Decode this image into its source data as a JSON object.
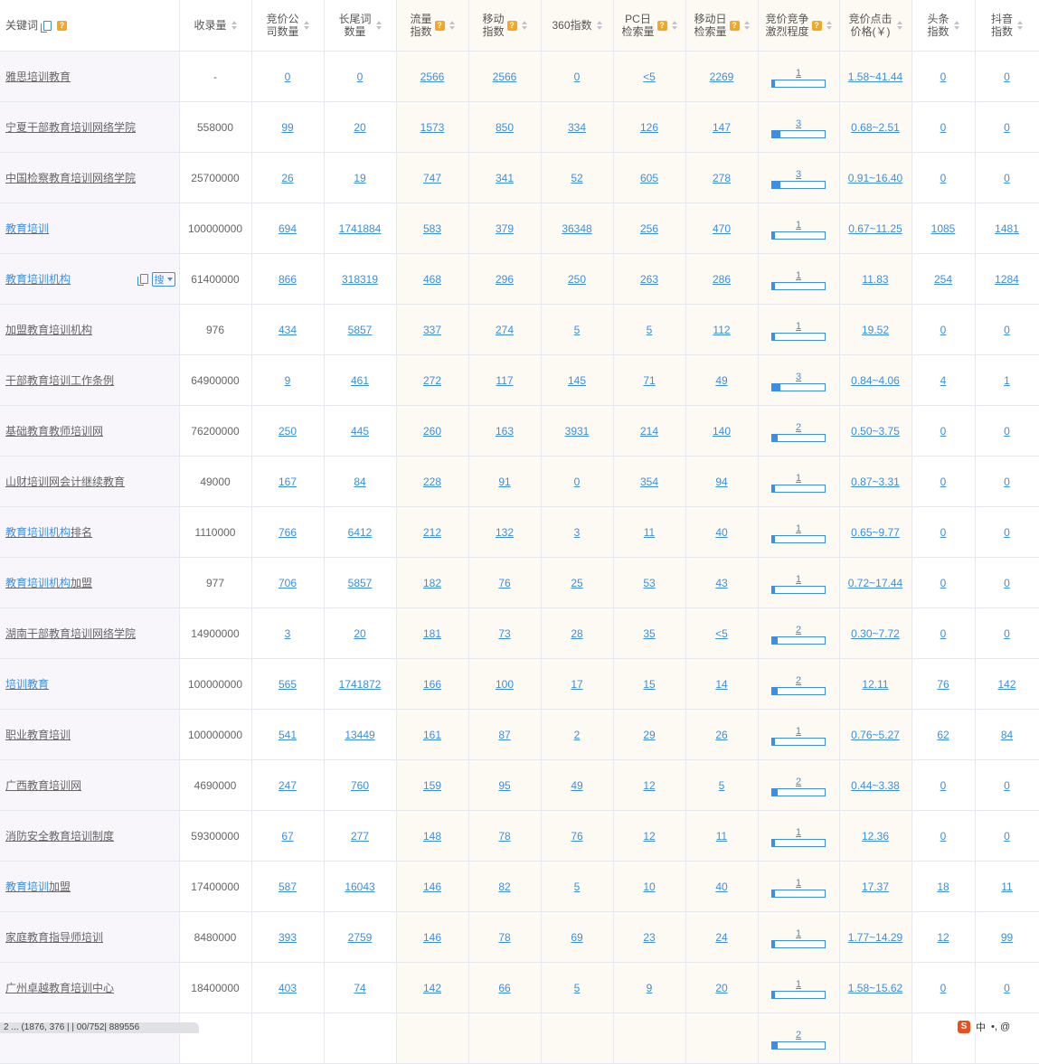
{
  "headers": {
    "keyword": "关键词",
    "shoulu": "收录量",
    "jingjia_company": [
      "竞价公",
      "司数量"
    ],
    "longtail": [
      "长尾词",
      "数量"
    ],
    "flow": [
      "流量",
      "指数"
    ],
    "mobile": [
      "移动",
      "指数"
    ],
    "idx360": "360指数",
    "pc": [
      "PC日",
      "检索量"
    ],
    "mobile_day": [
      "移动日",
      "检索量"
    ],
    "competition": [
      "竞价竞争",
      "激烈程度"
    ],
    "cpc": [
      "竞价点击",
      "价格(￥)"
    ],
    "toutiao": [
      "头条",
      "指数"
    ],
    "douyin": [
      "抖音",
      "指数"
    ]
  },
  "row_tools": {
    "sou_label": "搜"
  },
  "rows": [
    {
      "kw": "雅思培训教育",
      "hl": "",
      "shoulu": "-",
      "company": "0",
      "longtail": "0",
      "flow": "2566",
      "mobile": "2566",
      "i360": "0",
      "pc": "<5",
      "mday": "2269",
      "comp": "1",
      "cpc": "1.58~41.44",
      "tt": "0",
      "dy": "0"
    },
    {
      "kw": "宁夏干部教育培训网络学院",
      "hl": "",
      "shoulu": "558000",
      "company": "99",
      "longtail": "20",
      "flow": "1573",
      "mobile": "850",
      "i360": "334",
      "pc": "126",
      "mday": "147",
      "comp": "3",
      "cpc": "0.68~2.51",
      "tt": "0",
      "dy": "0"
    },
    {
      "kw": "中国检察教育培训网络学院",
      "hl": "",
      "shoulu": "25700000",
      "company": "26",
      "longtail": "19",
      "flow": "747",
      "mobile": "341",
      "i360": "52",
      "pc": "605",
      "mday": "278",
      "comp": "3",
      "cpc": "0.91~16.40",
      "tt": "0",
      "dy": "0"
    },
    {
      "kw": "教育培训",
      "hl": "教育培训",
      "shoulu": "100000000",
      "company": "694",
      "longtail": "1741884",
      "flow": "583",
      "mobile": "379",
      "i360": "36348",
      "pc": "256",
      "mday": "470",
      "comp": "1",
      "cpc": "0.67~11.25",
      "tt": "1085",
      "dy": "1481"
    },
    {
      "kw": "教育培训机构",
      "hl": "教育培训机构",
      "shoulu": "61400000",
      "company": "866",
      "longtail": "318319",
      "flow": "468",
      "mobile": "296",
      "i360": "250",
      "pc": "263",
      "mday": "286",
      "comp": "1",
      "cpc": "11.83",
      "tt": "254",
      "dy": "1284",
      "tools": true
    },
    {
      "kw": "加盟教育培训机构",
      "hl": "",
      "shoulu": "976",
      "company": "434",
      "longtail": "5857",
      "flow": "337",
      "mobile": "274",
      "i360": "5",
      "pc": "5",
      "mday": "112",
      "comp": "1",
      "cpc": "19.52",
      "tt": "0",
      "dy": "0"
    },
    {
      "kw": "干部教育培训工作条例",
      "hl": "",
      "shoulu": "64900000",
      "company": "9",
      "longtail": "461",
      "flow": "272",
      "mobile": "117",
      "i360": "145",
      "pc": "71",
      "mday": "49",
      "comp": "3",
      "cpc": "0.84~4.06",
      "tt": "4",
      "dy": "1"
    },
    {
      "kw": "基础教育教师培训网",
      "hl": "",
      "shoulu": "76200000",
      "company": "250",
      "longtail": "445",
      "flow": "260",
      "mobile": "163",
      "i360": "3931",
      "pc": "214",
      "mday": "140",
      "comp": "2",
      "cpc": "0.50~3.75",
      "tt": "0",
      "dy": "0"
    },
    {
      "kw": "山财培训网会计继续教育",
      "hl": "",
      "shoulu": "49000",
      "company": "167",
      "longtail": "84",
      "flow": "228",
      "mobile": "91",
      "i360": "0",
      "pc": "354",
      "mday": "94",
      "comp": "1",
      "cpc": "0.87~3.31",
      "tt": "0",
      "dy": "0"
    },
    {
      "kw": "教育培训机构排名",
      "hl": "教育培训机构",
      "shoulu": "1110000",
      "company": "766",
      "longtail": "6412",
      "flow": "212",
      "mobile": "132",
      "i360": "3",
      "pc": "11",
      "mday": "40",
      "comp": "1",
      "cpc": "0.65~9.77",
      "tt": "0",
      "dy": "0"
    },
    {
      "kw": "教育培训机构加盟",
      "hl": "教育培训机构",
      "shoulu": "977",
      "company": "706",
      "longtail": "5857",
      "flow": "182",
      "mobile": "76",
      "i360": "25",
      "pc": "53",
      "mday": "43",
      "comp": "1",
      "cpc": "0.72~17.44",
      "tt": "0",
      "dy": "0"
    },
    {
      "kw": "湖南干部教育培训网络学院",
      "hl": "",
      "shoulu": "14900000",
      "company": "3",
      "longtail": "20",
      "flow": "181",
      "mobile": "73",
      "i360": "28",
      "pc": "35",
      "mday": "<5",
      "comp": "2",
      "cpc": "0.30~7.72",
      "tt": "0",
      "dy": "0"
    },
    {
      "kw": "培训教育",
      "hl": "培训教育",
      "shoulu": "100000000",
      "company": "565",
      "longtail": "1741872",
      "flow": "166",
      "mobile": "100",
      "i360": "17",
      "pc": "15",
      "mday": "14",
      "comp": "2",
      "cpc": "12.11",
      "tt": "76",
      "dy": "142"
    },
    {
      "kw": "职业教育培训",
      "hl": "",
      "shoulu": "100000000",
      "company": "541",
      "longtail": "13449",
      "flow": "161",
      "mobile": "87",
      "i360": "2",
      "pc": "29",
      "mday": "26",
      "comp": "1",
      "cpc": "0.76~5.27",
      "tt": "62",
      "dy": "84"
    },
    {
      "kw": "广西教育培训网",
      "hl": "",
      "shoulu": "4690000",
      "company": "247",
      "longtail": "760",
      "flow": "159",
      "mobile": "95",
      "i360": "49",
      "pc": "12",
      "mday": "5",
      "comp": "2",
      "cpc": "0.44~3.38",
      "tt": "0",
      "dy": "0"
    },
    {
      "kw": "消防安全教育培训制度",
      "hl": "",
      "shoulu": "59300000",
      "company": "67",
      "longtail": "277",
      "flow": "148",
      "mobile": "78",
      "i360": "76",
      "pc": "12",
      "mday": "11",
      "comp": "1",
      "cpc": "12.36",
      "tt": "0",
      "dy": "0"
    },
    {
      "kw": "教育培训加盟",
      "hl": "教育培训",
      "shoulu": "17400000",
      "company": "587",
      "longtail": "16043",
      "flow": "146",
      "mobile": "82",
      "i360": "5",
      "pc": "10",
      "mday": "40",
      "comp": "1",
      "cpc": "17.37",
      "tt": "18",
      "dy": "11"
    },
    {
      "kw": "家庭教育指导师培训",
      "hl": "",
      "shoulu": "8480000",
      "company": "393",
      "longtail": "2759",
      "flow": "146",
      "mobile": "78",
      "i360": "69",
      "pc": "23",
      "mday": "24",
      "comp": "1",
      "cpc": "1.77~14.29",
      "tt": "12",
      "dy": "99"
    },
    {
      "kw": "广州卓越教育培训中心",
      "hl": "",
      "shoulu": "18400000",
      "company": "403",
      "longtail": "74",
      "flow": "142",
      "mobile": "66",
      "i360": "5",
      "pc": "9",
      "mday": "20",
      "comp": "1",
      "cpc": "1.58~15.62",
      "tt": "0",
      "dy": "0"
    },
    {
      "kw": "",
      "hl": "",
      "shoulu": "",
      "company": "",
      "longtail": "",
      "flow": "",
      "mobile": "",
      "i360": "",
      "pc": "",
      "mday": "",
      "comp": "2",
      "cpc": "",
      "tt": "",
      "dy": ""
    }
  ],
  "status_bar": "2 ... (1876, 376 | | 00/752| 889556",
  "ime": {
    "logo": "S",
    "lang": "中",
    "extra": "•, @"
  }
}
